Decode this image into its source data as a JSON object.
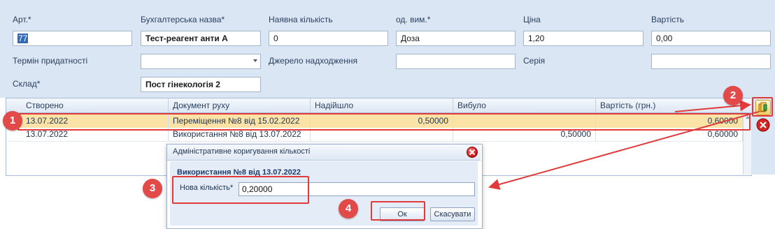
{
  "form": {
    "art_label": "Арт.*",
    "art_value": "77",
    "name_label": "Бухгалтерська назва*",
    "name_value": "Тест-реагент анти А",
    "qty_label": "Наявна кількість",
    "qty_value": "0",
    "unit_label": "од. вим.*",
    "unit_value": "Доза",
    "price_label": "Ціна",
    "price_value": "1,20",
    "cost_label": "Вартість",
    "cost_value": "0,00",
    "expiry_label": "Термін придатності",
    "expiry_value": "",
    "source_label": "Джерело надходження",
    "source_value": "",
    "series_label": "Серія",
    "series_value": "",
    "warehouse_label": "Склад*",
    "warehouse_value": "Пост гінекологія 2"
  },
  "table": {
    "columns": [
      "Створено",
      "Документ руху",
      "Надійшло",
      "Вибуло",
      "Вартість (грн.)"
    ],
    "rows": [
      {
        "created": "13.07.2022",
        "doc": "Переміщення №8 від 15.02.2022",
        "in": "0,50000",
        "out": "",
        "cost": "0,60000"
      },
      {
        "created": "13.07.2022",
        "doc": "Використання №8 від 13.07.2022",
        "in": "",
        "out": "0,50000",
        "cost": "0,60000"
      }
    ]
  },
  "dialog": {
    "title": "Адміністративне коригування кількості",
    "doc_label": "Використання №8 від 13.07.2022",
    "qty_label": "Нова кількість*",
    "qty_value": "0,20000",
    "ok_label": "Ок",
    "cancel_label": "Скасувати"
  },
  "callouts": [
    "1",
    "2",
    "3",
    "4"
  ],
  "colors": {
    "highlight": "#e03a3a",
    "selected_row": "#fbe3a8",
    "form_bg": "#dbe6f4"
  },
  "icons": [
    "dropdown-arrow-icon",
    "edit-quantity-icon",
    "delete-icon",
    "close-icon",
    "scroll-up-icon"
  ]
}
